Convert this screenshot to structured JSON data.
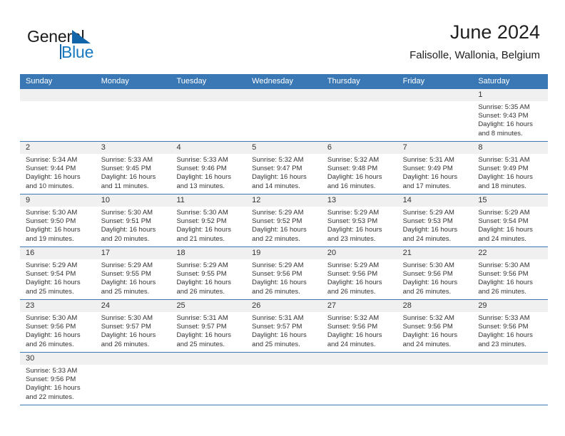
{
  "brand": {
    "word_one": "General",
    "word_two": "Blue",
    "logo_icon": "triangle-flag-icon"
  },
  "header": {
    "month_year": "June 2024",
    "location": "Falisolle, Wallonia, Belgium"
  },
  "colors": {
    "header_bar": "#3a78b5",
    "daynum_band": "#f0f0f0",
    "brand_blue": "#1879bf",
    "text": "#333333"
  },
  "weekdays": [
    "Sunday",
    "Monday",
    "Tuesday",
    "Wednesday",
    "Thursday",
    "Friday",
    "Saturday"
  ],
  "weeks": [
    [
      {
        "day": "",
        "lines": []
      },
      {
        "day": "",
        "lines": []
      },
      {
        "day": "",
        "lines": []
      },
      {
        "day": "",
        "lines": []
      },
      {
        "day": "",
        "lines": []
      },
      {
        "day": "",
        "lines": []
      },
      {
        "day": "1",
        "lines": [
          "Sunrise: 5:35 AM",
          "Sunset: 9:43 PM",
          "Daylight: 16 hours",
          "and 8 minutes."
        ]
      }
    ],
    [
      {
        "day": "2",
        "lines": [
          "Sunrise: 5:34 AM",
          "Sunset: 9:44 PM",
          "Daylight: 16 hours",
          "and 10 minutes."
        ]
      },
      {
        "day": "3",
        "lines": [
          "Sunrise: 5:33 AM",
          "Sunset: 9:45 PM",
          "Daylight: 16 hours",
          "and 11 minutes."
        ]
      },
      {
        "day": "4",
        "lines": [
          "Sunrise: 5:33 AM",
          "Sunset: 9:46 PM",
          "Daylight: 16 hours",
          "and 13 minutes."
        ]
      },
      {
        "day": "5",
        "lines": [
          "Sunrise: 5:32 AM",
          "Sunset: 9:47 PM",
          "Daylight: 16 hours",
          "and 14 minutes."
        ]
      },
      {
        "day": "6",
        "lines": [
          "Sunrise: 5:32 AM",
          "Sunset: 9:48 PM",
          "Daylight: 16 hours",
          "and 16 minutes."
        ]
      },
      {
        "day": "7",
        "lines": [
          "Sunrise: 5:31 AM",
          "Sunset: 9:49 PM",
          "Daylight: 16 hours",
          "and 17 minutes."
        ]
      },
      {
        "day": "8",
        "lines": [
          "Sunrise: 5:31 AM",
          "Sunset: 9:49 PM",
          "Daylight: 16 hours",
          "and 18 minutes."
        ]
      }
    ],
    [
      {
        "day": "9",
        "lines": [
          "Sunrise: 5:30 AM",
          "Sunset: 9:50 PM",
          "Daylight: 16 hours",
          "and 19 minutes."
        ]
      },
      {
        "day": "10",
        "lines": [
          "Sunrise: 5:30 AM",
          "Sunset: 9:51 PM",
          "Daylight: 16 hours",
          "and 20 minutes."
        ]
      },
      {
        "day": "11",
        "lines": [
          "Sunrise: 5:30 AM",
          "Sunset: 9:52 PM",
          "Daylight: 16 hours",
          "and 21 minutes."
        ]
      },
      {
        "day": "12",
        "lines": [
          "Sunrise: 5:29 AM",
          "Sunset: 9:52 PM",
          "Daylight: 16 hours",
          "and 22 minutes."
        ]
      },
      {
        "day": "13",
        "lines": [
          "Sunrise: 5:29 AM",
          "Sunset: 9:53 PM",
          "Daylight: 16 hours",
          "and 23 minutes."
        ]
      },
      {
        "day": "14",
        "lines": [
          "Sunrise: 5:29 AM",
          "Sunset: 9:53 PM",
          "Daylight: 16 hours",
          "and 24 minutes."
        ]
      },
      {
        "day": "15",
        "lines": [
          "Sunrise: 5:29 AM",
          "Sunset: 9:54 PM",
          "Daylight: 16 hours",
          "and 24 minutes."
        ]
      }
    ],
    [
      {
        "day": "16",
        "lines": [
          "Sunrise: 5:29 AM",
          "Sunset: 9:54 PM",
          "Daylight: 16 hours",
          "and 25 minutes."
        ]
      },
      {
        "day": "17",
        "lines": [
          "Sunrise: 5:29 AM",
          "Sunset: 9:55 PM",
          "Daylight: 16 hours",
          "and 25 minutes."
        ]
      },
      {
        "day": "18",
        "lines": [
          "Sunrise: 5:29 AM",
          "Sunset: 9:55 PM",
          "Daylight: 16 hours",
          "and 26 minutes."
        ]
      },
      {
        "day": "19",
        "lines": [
          "Sunrise: 5:29 AM",
          "Sunset: 9:56 PM",
          "Daylight: 16 hours",
          "and 26 minutes."
        ]
      },
      {
        "day": "20",
        "lines": [
          "Sunrise: 5:29 AM",
          "Sunset: 9:56 PM",
          "Daylight: 16 hours",
          "and 26 minutes."
        ]
      },
      {
        "day": "21",
        "lines": [
          "Sunrise: 5:30 AM",
          "Sunset: 9:56 PM",
          "Daylight: 16 hours",
          "and 26 minutes."
        ]
      },
      {
        "day": "22",
        "lines": [
          "Sunrise: 5:30 AM",
          "Sunset: 9:56 PM",
          "Daylight: 16 hours",
          "and 26 minutes."
        ]
      }
    ],
    [
      {
        "day": "23",
        "lines": [
          "Sunrise: 5:30 AM",
          "Sunset: 9:56 PM",
          "Daylight: 16 hours",
          "and 26 minutes."
        ]
      },
      {
        "day": "24",
        "lines": [
          "Sunrise: 5:30 AM",
          "Sunset: 9:57 PM",
          "Daylight: 16 hours",
          "and 26 minutes."
        ]
      },
      {
        "day": "25",
        "lines": [
          "Sunrise: 5:31 AM",
          "Sunset: 9:57 PM",
          "Daylight: 16 hours",
          "and 25 minutes."
        ]
      },
      {
        "day": "26",
        "lines": [
          "Sunrise: 5:31 AM",
          "Sunset: 9:57 PM",
          "Daylight: 16 hours",
          "and 25 minutes."
        ]
      },
      {
        "day": "27",
        "lines": [
          "Sunrise: 5:32 AM",
          "Sunset: 9:56 PM",
          "Daylight: 16 hours",
          "and 24 minutes."
        ]
      },
      {
        "day": "28",
        "lines": [
          "Sunrise: 5:32 AM",
          "Sunset: 9:56 PM",
          "Daylight: 16 hours",
          "and 24 minutes."
        ]
      },
      {
        "day": "29",
        "lines": [
          "Sunrise: 5:33 AM",
          "Sunset: 9:56 PM",
          "Daylight: 16 hours",
          "and 23 minutes."
        ]
      }
    ],
    [
      {
        "day": "30",
        "lines": [
          "Sunrise: 5:33 AM",
          "Sunset: 9:56 PM",
          "Daylight: 16 hours",
          "and 22 minutes."
        ]
      },
      {
        "day": "",
        "lines": []
      },
      {
        "day": "",
        "lines": []
      },
      {
        "day": "",
        "lines": []
      },
      {
        "day": "",
        "lines": []
      },
      {
        "day": "",
        "lines": []
      },
      {
        "day": "",
        "lines": []
      }
    ]
  ]
}
